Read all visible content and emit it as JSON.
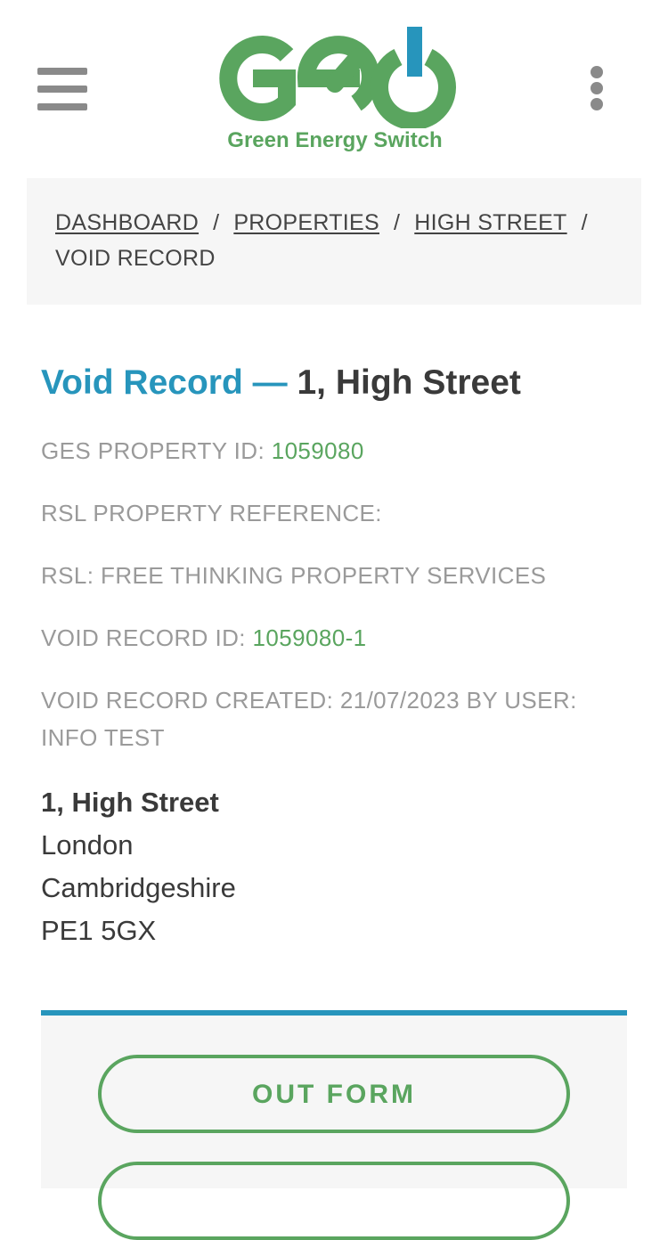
{
  "header": {
    "logo_text": "Green Energy Switch",
    "brand_colors": {
      "green": "#5aa55f",
      "blue": "#2795bc"
    },
    "menu_icon": "hamburger-menu-icon",
    "more_icon": "vertical-ellipsis-icon"
  },
  "breadcrumb": {
    "items": [
      {
        "label": "DASHBOARD",
        "link": true
      },
      {
        "label": "PROPERTIES",
        "link": true
      },
      {
        "label": "HIGH STREET",
        "link": true
      },
      {
        "label": "VOID RECORD",
        "link": false
      }
    ],
    "separator": "/"
  },
  "title": {
    "prefix": "Void Record —",
    "property": "1, High Street"
  },
  "details": {
    "ges_property_id_label": "GES PROPERTY ID:",
    "ges_property_id_value": "1059080",
    "rsl_property_reference_label": "RSL PROPERTY REFERENCE:",
    "rsl_property_reference_value": "",
    "rsl_label": "RSL:",
    "rsl_value": "FREE THINKING PROPERTY SERVICES",
    "void_record_id_label": "VOID RECORD ID:",
    "void_record_id_value": "1059080-1",
    "created_label": "VOID RECORD CREATED:",
    "created_date": "21/07/2023",
    "created_by_label": "BY USER:",
    "created_by": "INFO TEST"
  },
  "address": {
    "line1": "1, High Street",
    "city": "London",
    "county": "Cambridgeshire",
    "postcode": "PE1 5GX"
  },
  "actions": {
    "out_form_label": "OUT FORM",
    "next_label": ""
  }
}
